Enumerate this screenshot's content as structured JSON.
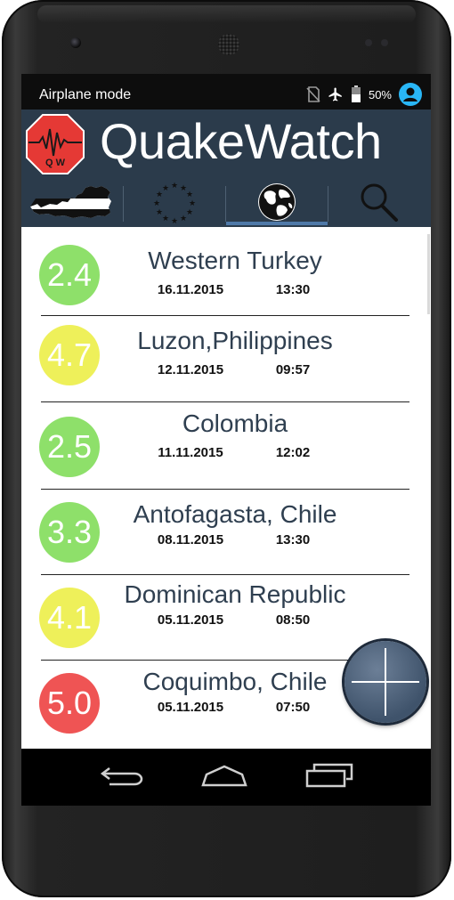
{
  "status_bar": {
    "mode_text": "Airplane mode",
    "icons": [
      "no-sim-icon",
      "airplane-icon",
      "battery-icon",
      "account-icon"
    ],
    "battery_percent": "50%",
    "account_color": "#29b6f6"
  },
  "app": {
    "title": "QuakeWatch",
    "logo_text": "Q W",
    "header_color": "#2b3b4b",
    "logo_color": "#e53935"
  },
  "tabs": [
    {
      "name": "austria-map",
      "icon": "austria-map-icon"
    },
    {
      "name": "europe",
      "icon": "eu-stars-icon"
    },
    {
      "name": "world",
      "icon": "globe-icon",
      "selected": true
    },
    {
      "name": "search",
      "icon": "search-icon"
    }
  ],
  "quakes": [
    {
      "magnitude": "2.4",
      "place": "Western Turkey",
      "date": "16.11.2015",
      "time": "13:30",
      "color": "#8ee06a"
    },
    {
      "magnitude": "4.7",
      "place": "Luzon,Philippines",
      "date": "12.11.2015",
      "time": "09:57",
      "color": "#eef05a"
    },
    {
      "magnitude": "2.5",
      "place": "Colombia",
      "date": "11.11.2015",
      "time": "12:02",
      "color": "#8ee06a"
    },
    {
      "magnitude": "3.3",
      "place": "Antofagasta, Chile",
      "date": "08.11.2015",
      "time": "13:30",
      "color": "#8ee06a"
    },
    {
      "magnitude": "4.1",
      "place": "Dominican Republic",
      "date": "05.11.2015",
      "time": "08:50",
      "color": "#eef05a"
    },
    {
      "magnitude": "5.0",
      "place": "Coquimbo, Chile",
      "date": "05.11.2015",
      "time": "07:50",
      "color": "#ef5454"
    }
  ],
  "fab": {
    "icon": "plus-icon"
  },
  "nav_bar": {
    "buttons": [
      "back-icon",
      "home-icon",
      "recents-icon"
    ]
  }
}
